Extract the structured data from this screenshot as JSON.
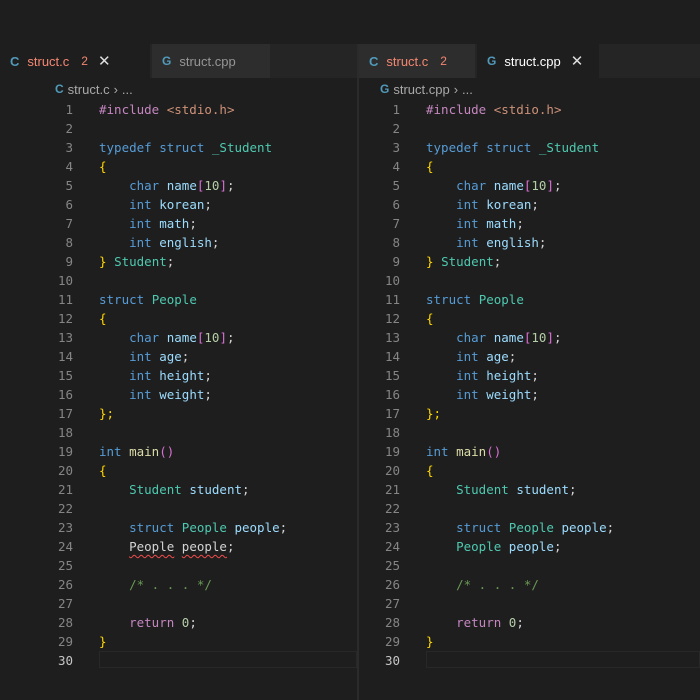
{
  "left_pane": {
    "tabs": [
      {
        "label": "struct.c",
        "icon": "C",
        "badge": "2",
        "active": true,
        "error": true,
        "closable": true
      },
      {
        "label": "struct.cpp",
        "icon": "G",
        "active": false,
        "error": false
      }
    ],
    "breadcrumb": {
      "file": "struct.c",
      "rest": "..."
    },
    "lines": [
      [
        [
          "#include ",
          "t-ctl"
        ],
        [
          "<stdio.h>",
          "t-str"
        ]
      ],
      [],
      [
        [
          "typedef ",
          "t-kw"
        ],
        [
          "struct ",
          "t-kw"
        ],
        [
          "_Student",
          "t-type"
        ]
      ],
      [
        [
          "{",
          "t-p1"
        ]
      ],
      [
        [
          "    ",
          ""
        ],
        [
          "char ",
          "t-kw"
        ],
        [
          "name",
          "t-var"
        ],
        [
          "[",
          "t-p2"
        ],
        [
          "10",
          "t-num"
        ],
        [
          "]",
          "t-p2"
        ],
        [
          ";",
          "t-pl"
        ]
      ],
      [
        [
          "    ",
          ""
        ],
        [
          "int ",
          "t-kw"
        ],
        [
          "korean",
          "t-var"
        ],
        [
          ";",
          "t-pl"
        ]
      ],
      [
        [
          "    ",
          ""
        ],
        [
          "int ",
          "t-kw"
        ],
        [
          "math",
          "t-var"
        ],
        [
          ";",
          "t-pl"
        ]
      ],
      [
        [
          "    ",
          ""
        ],
        [
          "int ",
          "t-kw"
        ],
        [
          "english",
          "t-var"
        ],
        [
          ";",
          "t-pl"
        ]
      ],
      [
        [
          "} ",
          "t-p1"
        ],
        [
          "Student",
          "t-type"
        ],
        [
          ";",
          "t-pl"
        ]
      ],
      [],
      [
        [
          "struct ",
          "t-kw"
        ],
        [
          "People",
          "t-type"
        ]
      ],
      [
        [
          "{",
          "t-p1"
        ]
      ],
      [
        [
          "    ",
          ""
        ],
        [
          "char ",
          "t-kw"
        ],
        [
          "name",
          "t-var"
        ],
        [
          "[",
          "t-p2"
        ],
        [
          "10",
          "t-num"
        ],
        [
          "]",
          "t-p2"
        ],
        [
          ";",
          "t-pl"
        ]
      ],
      [
        [
          "    ",
          ""
        ],
        [
          "int ",
          "t-kw"
        ],
        [
          "age",
          "t-var"
        ],
        [
          ";",
          "t-pl"
        ]
      ],
      [
        [
          "    ",
          ""
        ],
        [
          "int ",
          "t-kw"
        ],
        [
          "height",
          "t-var"
        ],
        [
          ";",
          "t-pl"
        ]
      ],
      [
        [
          "    ",
          ""
        ],
        [
          "int ",
          "t-kw"
        ],
        [
          "weight",
          "t-var"
        ],
        [
          ";",
          "t-pl"
        ]
      ],
      [
        [
          "};",
          "t-p1"
        ]
      ],
      [],
      [
        [
          "int ",
          "t-kw"
        ],
        [
          "main",
          "t-fn"
        ],
        [
          "()",
          "t-p2"
        ]
      ],
      [
        [
          "{",
          "t-p1"
        ]
      ],
      [
        [
          "    ",
          ""
        ],
        [
          "Student ",
          "t-type"
        ],
        [
          "student",
          "t-var"
        ],
        [
          ";",
          "t-pl"
        ]
      ],
      [],
      [
        [
          "    ",
          ""
        ],
        [
          "struct ",
          "t-kw"
        ],
        [
          "People ",
          "t-type"
        ],
        [
          "people",
          "t-var"
        ],
        [
          ";",
          "t-pl"
        ]
      ],
      [
        [
          "    ",
          ""
        ],
        [
          "People",
          "t-pl squig"
        ],
        [
          " ",
          ""
        ],
        [
          "people",
          "t-pl squig"
        ],
        [
          ";",
          "t-pl"
        ]
      ],
      [],
      [
        [
          "    ",
          ""
        ],
        [
          "/* . . . */",
          "t-com"
        ]
      ],
      [],
      [
        [
          "    ",
          ""
        ],
        [
          "return ",
          "t-ctl"
        ],
        [
          "0",
          "t-num"
        ],
        [
          ";",
          "t-pl"
        ]
      ],
      [
        [
          "}",
          "t-p1"
        ]
      ],
      []
    ]
  },
  "right_pane": {
    "tabs": [
      {
        "label": "struct.c",
        "icon": "C",
        "badge": "2",
        "active": false,
        "error": true
      },
      {
        "label": "struct.cpp",
        "icon": "G",
        "active": true,
        "error": false,
        "closable": true
      }
    ],
    "breadcrumb": {
      "file": "struct.cpp",
      "rest": "..."
    },
    "lines": [
      [
        [
          "#include ",
          "t-ctl"
        ],
        [
          "<stdio.h>",
          "t-str"
        ]
      ],
      [],
      [
        [
          "typedef ",
          "t-kw"
        ],
        [
          "struct ",
          "t-kw"
        ],
        [
          "_Student",
          "t-type"
        ]
      ],
      [
        [
          "{",
          "t-p1"
        ]
      ],
      [
        [
          "    ",
          ""
        ],
        [
          "char ",
          "t-kw"
        ],
        [
          "name",
          "t-var"
        ],
        [
          "[",
          "t-p2"
        ],
        [
          "10",
          "t-num"
        ],
        [
          "]",
          "t-p2"
        ],
        [
          ";",
          "t-pl"
        ]
      ],
      [
        [
          "    ",
          ""
        ],
        [
          "int ",
          "t-kw"
        ],
        [
          "korean",
          "t-var"
        ],
        [
          ";",
          "t-pl"
        ]
      ],
      [
        [
          "    ",
          ""
        ],
        [
          "int ",
          "t-kw"
        ],
        [
          "math",
          "t-var"
        ],
        [
          ";",
          "t-pl"
        ]
      ],
      [
        [
          "    ",
          ""
        ],
        [
          "int ",
          "t-kw"
        ],
        [
          "english",
          "t-var"
        ],
        [
          ";",
          "t-pl"
        ]
      ],
      [
        [
          "} ",
          "t-p1"
        ],
        [
          "Student",
          "t-type"
        ],
        [
          ";",
          "t-pl"
        ]
      ],
      [],
      [
        [
          "struct ",
          "t-kw"
        ],
        [
          "People",
          "t-type"
        ]
      ],
      [
        [
          "{",
          "t-p1"
        ]
      ],
      [
        [
          "    ",
          ""
        ],
        [
          "char ",
          "t-kw"
        ],
        [
          "name",
          "t-var"
        ],
        [
          "[",
          "t-p2"
        ],
        [
          "10",
          "t-num"
        ],
        [
          "]",
          "t-p2"
        ],
        [
          ";",
          "t-pl"
        ]
      ],
      [
        [
          "    ",
          ""
        ],
        [
          "int ",
          "t-kw"
        ],
        [
          "age",
          "t-var"
        ],
        [
          ";",
          "t-pl"
        ]
      ],
      [
        [
          "    ",
          ""
        ],
        [
          "int ",
          "t-kw"
        ],
        [
          "height",
          "t-var"
        ],
        [
          ";",
          "t-pl"
        ]
      ],
      [
        [
          "    ",
          ""
        ],
        [
          "int ",
          "t-kw"
        ],
        [
          "weight",
          "t-var"
        ],
        [
          ";",
          "t-pl"
        ]
      ],
      [
        [
          "};",
          "t-p1"
        ]
      ],
      [],
      [
        [
          "int ",
          "t-kw"
        ],
        [
          "main",
          "t-fn"
        ],
        [
          "()",
          "t-p2"
        ]
      ],
      [
        [
          "{",
          "t-p1"
        ]
      ],
      [
        [
          "    ",
          ""
        ],
        [
          "Student ",
          "t-type"
        ],
        [
          "student",
          "t-var"
        ],
        [
          ";",
          "t-pl"
        ]
      ],
      [],
      [
        [
          "    ",
          ""
        ],
        [
          "struct ",
          "t-kw"
        ],
        [
          "People ",
          "t-type"
        ],
        [
          "people",
          "t-var"
        ],
        [
          ";",
          "t-pl"
        ]
      ],
      [
        [
          "    ",
          ""
        ],
        [
          "People ",
          "t-type"
        ],
        [
          "people",
          "t-var"
        ],
        [
          ";",
          "t-pl"
        ]
      ],
      [],
      [
        [
          "    ",
          ""
        ],
        [
          "/* . . . */",
          "t-com"
        ]
      ],
      [],
      [
        [
          "    ",
          ""
        ],
        [
          "return ",
          "t-ctl"
        ],
        [
          "0",
          "t-num"
        ],
        [
          ";",
          "t-pl"
        ]
      ],
      [
        [
          "}",
          "t-p1"
        ]
      ],
      []
    ]
  },
  "current_line": 30,
  "close_glyph": "✕"
}
